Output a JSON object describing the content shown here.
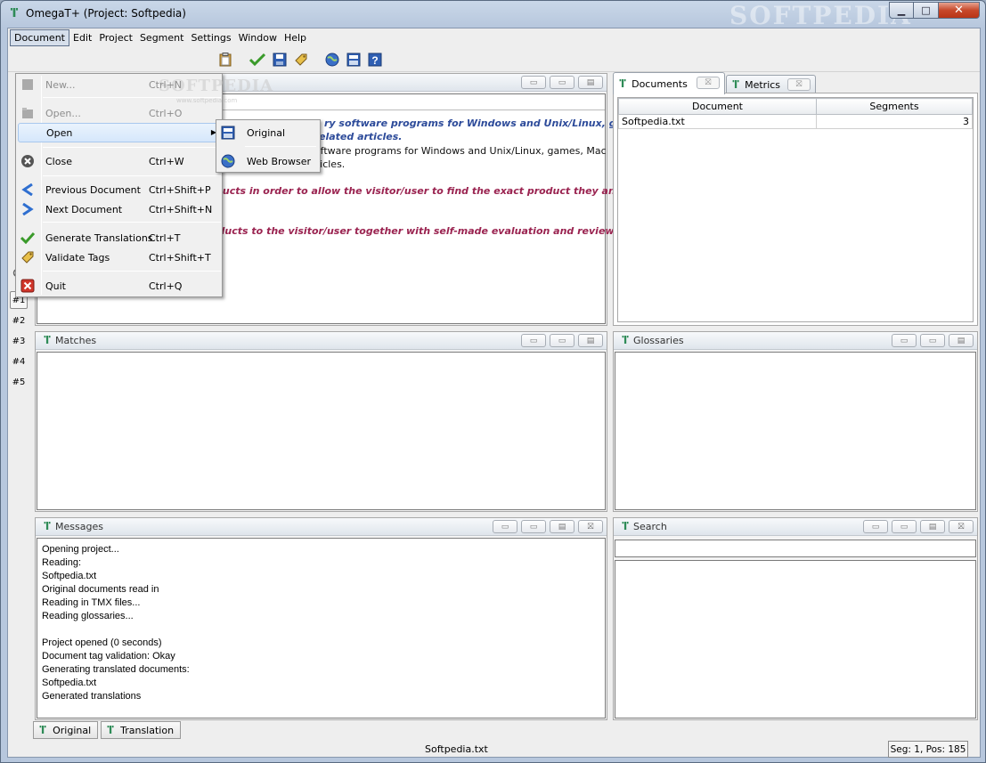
{
  "window": {
    "title": "OmegaT+ (Project: Softpedia)",
    "watermark": "SOFTPEDIA",
    "controls": {
      "minimize": "▁",
      "maximize": "□",
      "close": "✕"
    }
  },
  "menubar": [
    "Document",
    "Edit",
    "Project",
    "Segment",
    "Settings",
    "Window",
    "Help"
  ],
  "document_menu": {
    "items": [
      {
        "label": "New...",
        "shortcut": "Ctrl+N",
        "icon": "new-icon"
      },
      {
        "label": "Open...",
        "shortcut": "Ctrl+O",
        "icon": "open-icon"
      },
      {
        "label": "Open",
        "shortcut": "",
        "icon": ""
      },
      {
        "label": "Close",
        "shortcut": "Ctrl+W",
        "icon": "close-doc-icon"
      },
      {
        "label": "Previous Document",
        "shortcut": "Ctrl+Shift+P",
        "icon": "prev-icon"
      },
      {
        "label": "Next Document",
        "shortcut": "Ctrl+Shift+N",
        "icon": "next-icon"
      },
      {
        "label": "Generate Translations",
        "shortcut": "Ctrl+T",
        "icon": "check-icon"
      },
      {
        "label": "Validate Tags",
        "shortcut": "Ctrl+Shift+T",
        "icon": "tag-icon"
      },
      {
        "label": "Quit",
        "shortcut": "Ctrl+Q",
        "icon": "quit-icon"
      }
    ],
    "watermark": "SOFTPEDIA",
    "watermark_small": "www.softpedia.com"
  },
  "open_submenu": [
    "Original",
    "Web Browser"
  ],
  "editor": {
    "lines": [
      "ry software programs for Windows and Unix/Linux, games,",
      "elated articles.",
      "ree and free-to-try software programs for Windows and Unix/Linux, games, Mac",
      "ces and IT-related articles.",
      "ducts in order to allow the visitor/user to find the exact product they and their",
      "oducts to the visitor/user together with self-made evaluation and review notes."
    ]
  },
  "left_strip": [
    "#1",
    "#2",
    "#3",
    "#4",
    "#5"
  ],
  "documents_panel": {
    "tabs": [
      "Documents",
      "Metrics"
    ],
    "columns": [
      "Document",
      "Segments"
    ],
    "rows": [
      {
        "document": "Softpedia.txt",
        "segments": "3"
      }
    ]
  },
  "panes": {
    "matches": "Matches",
    "glossaries": "Glossaries",
    "messages": "Messages",
    "search": "Search"
  },
  "messages": [
    "Opening project...",
    "Reading:",
    "Softpedia.txt",
    "Original documents read in",
    "Reading in TMX files...",
    "Reading glossaries...",
    "",
    "Project opened (0 seconds)",
    "Document tag validation: Okay",
    "Generating translated documents:",
    "Softpedia.txt",
    "Generated translations"
  ],
  "bottom_tabs": [
    "Original",
    "Translation"
  ],
  "status": {
    "file": "Softpedia.txt",
    "position": "Seg: 1, Pos: 185"
  },
  "colors": {
    "source_text": "#2d4b9a",
    "target_text": "#9a2350",
    "app_icon": "#2e8b57"
  }
}
